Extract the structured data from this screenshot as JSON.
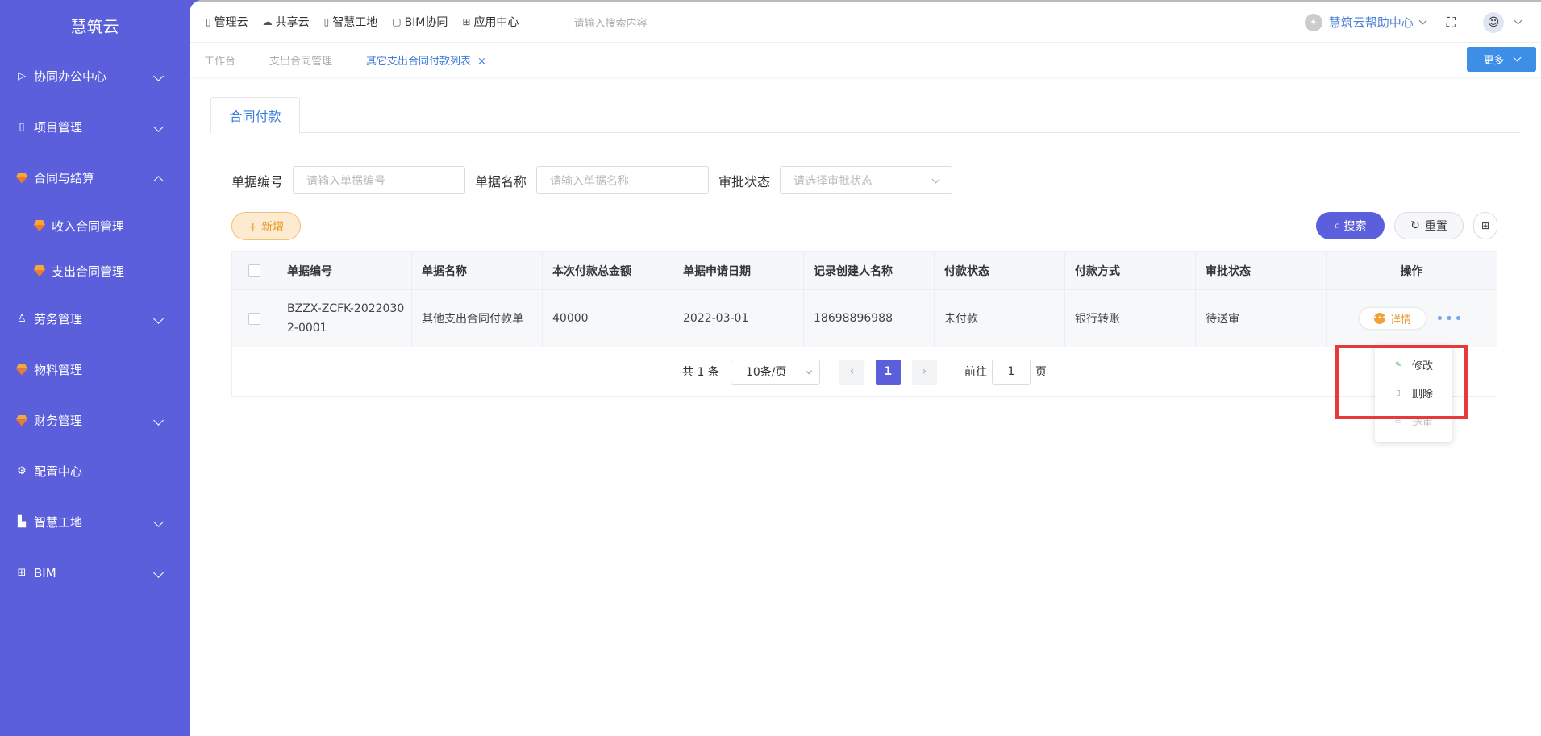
{
  "app": {
    "logo": "慧筑云"
  },
  "sidebar": {
    "items": [
      {
        "label": "协同办公中心",
        "icon": "send-icon",
        "expanded": false
      },
      {
        "label": "项目管理",
        "icon": "book-icon",
        "expanded": false
      },
      {
        "label": "合同与结算",
        "icon": "gem-icon",
        "expanded": true
      },
      {
        "label": "收入合同管理",
        "icon": "gem-icon",
        "sub": true
      },
      {
        "label": "支出合同管理",
        "icon": "gem-icon",
        "sub": true
      },
      {
        "label": "劳务管理",
        "icon": "user-icon",
        "expanded": false
      },
      {
        "label": "物料管理",
        "icon": "gem-icon"
      },
      {
        "label": "财务管理",
        "icon": "gem-icon",
        "expanded": false
      },
      {
        "label": "配置中心",
        "icon": "gear-icon"
      },
      {
        "label": "智慧工地",
        "icon": "bar-chart-icon",
        "expanded": false
      },
      {
        "label": "BIM",
        "icon": "grid-icon",
        "expanded": false
      }
    ]
  },
  "topbar": {
    "nav": [
      "管理云",
      "共享云",
      "智慧工地",
      "BIM协同",
      "应用中心"
    ],
    "search_placeholder": "请输入搜索内容",
    "help": "慧筑云帮助中心"
  },
  "tabs": {
    "items": [
      "工作台",
      "支出合同管理",
      "其它支出合同付款列表"
    ],
    "close": "×",
    "more": "更多"
  },
  "subtab": "合同付款",
  "filters": {
    "doc_no_label": "单据编号",
    "doc_no_placeholder": "请输入单据编号",
    "doc_name_label": "单据名称",
    "doc_name_placeholder": "请输入单据名称",
    "status_label": "审批状态",
    "status_placeholder": "请选择审批状态"
  },
  "actions": {
    "add": "+ 新增",
    "search": "搜索",
    "reset": "重置"
  },
  "table": {
    "headers": [
      "单据编号",
      "单据名称",
      "本次付款总金额",
      "单据申请日期",
      "记录创建人名称",
      "付款状态",
      "付款方式",
      "审批状态",
      "操作"
    ],
    "rows": [
      {
        "doc_no": "BZZX-ZCFK-20220302-0001",
        "doc_name": "其他支出合同付款单",
        "amount": "40000",
        "date": "2022-03-01",
        "creator": "18698896988",
        "pay_status": "未付款",
        "pay_method": "银行转账",
        "approval": "待送审",
        "detail": "详情"
      }
    ]
  },
  "pager": {
    "total": "共 1 条",
    "page_size": "10条/页",
    "current": "1",
    "goto_prefix": "前往",
    "goto_value": "1",
    "goto_suffix": "页"
  },
  "dropdown": {
    "items": [
      "修改",
      "删除",
      "送审"
    ]
  },
  "colors": {
    "sidebar": "#5b5fdb",
    "accent": "#3d7bdc",
    "highlight": "#e8393b"
  }
}
